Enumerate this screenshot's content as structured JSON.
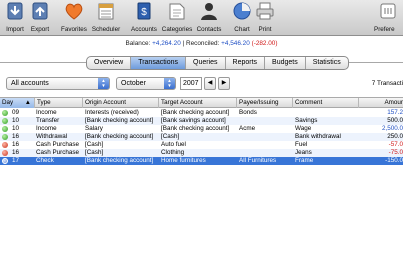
{
  "toolbar": {
    "items": [
      {
        "label": "Import",
        "icon": "import-icon"
      },
      {
        "label": "Export",
        "icon": "export-icon"
      },
      {
        "label": "Favorites",
        "icon": "heart-icon"
      },
      {
        "label": "Scheduler",
        "icon": "scheduler-icon"
      },
      {
        "label": "Accounts",
        "icon": "accounts-icon"
      },
      {
        "label": "Categories",
        "icon": "categories-icon"
      },
      {
        "label": "Contacts",
        "icon": "contacts-icon"
      },
      {
        "label": "Chart",
        "icon": "chart-icon"
      },
      {
        "label": "Print",
        "icon": "print-icon"
      },
      {
        "label": "Prefere",
        "icon": "preferences-icon"
      }
    ]
  },
  "balance": {
    "balance_label": "Balance:",
    "balance_value": "+4,264.20",
    "separator": "|",
    "reconciled_label": "Reconciled:",
    "reconciled_value": "+4,546.20",
    "reconciled_diff": "(-282.00)"
  },
  "tabs": [
    "Overview",
    "Transactions",
    "Queries",
    "Reports",
    "Budgets",
    "Statistics"
  ],
  "active_tab": "Transactions",
  "filters": {
    "account": "All accounts",
    "month": "October",
    "year": "2007",
    "prev": "◀",
    "next": "▶",
    "count_text": "7 Transacti"
  },
  "table": {
    "columns": [
      "Day",
      "Type",
      "Origin Account",
      "Target Account",
      "Payee/Issuing",
      "Comment",
      "Amour"
    ],
    "rows": [
      {
        "status": "green",
        "day": "09",
        "type": "Income",
        "origin": "Interests (received)",
        "target": "[Bank checking account]",
        "payee": "Bonds",
        "comment": "",
        "amount": "157.2",
        "sign": "pos"
      },
      {
        "status": "green",
        "day": "10",
        "type": "Transfer",
        "origin": "[Bank checking account]",
        "target": "[Bank savings account]",
        "payee": "",
        "comment": "Savings",
        "amount": "500.0",
        "sign": "plain"
      },
      {
        "status": "green",
        "day": "10",
        "type": "Income",
        "origin": "Salary",
        "target": "[Bank checking account]",
        "payee": "Acme",
        "comment": "Wage",
        "amount": "2,500.0",
        "sign": "pos"
      },
      {
        "status": "green",
        "day": "16",
        "type": "Withdrawal",
        "origin": "[Bank checking account]",
        "target": "[Cash]",
        "payee": "",
        "comment": "Bank withdrawal",
        "amount": "250.0",
        "sign": "plain"
      },
      {
        "status": "red",
        "day": "16",
        "type": "Cash Purchase",
        "origin": "[Cash]",
        "target": "Auto fuel",
        "payee": "",
        "comment": "Fuel",
        "amount": "-57.0",
        "sign": "neg"
      },
      {
        "status": "red",
        "day": "16",
        "type": "Cash Purchase",
        "origin": "[Cash]",
        "target": "Clothing",
        "payee": "",
        "comment": "Jeans",
        "amount": "-75.0",
        "sign": "neg"
      },
      {
        "status": "blue",
        "day": "17",
        "type": "Check",
        "origin": "[Bank checking account]",
        "target": "Home furnitures",
        "payee": "All Furnitures",
        "comment": "Frame",
        "amount": "-150.0",
        "sign": "neg",
        "selected": true
      }
    ]
  },
  "colors": {
    "positive": "#1f4fc4",
    "negative": "#d01818",
    "selection": "#3875d7"
  }
}
